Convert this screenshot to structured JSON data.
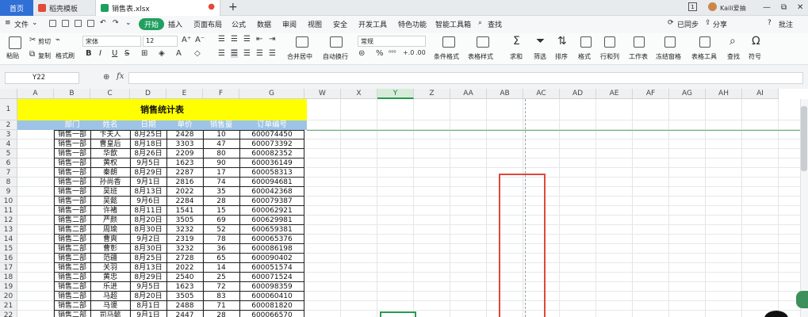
{
  "tabs": {
    "home": "首页",
    "template": "稻壳模板",
    "file": "销售表.xlsx",
    "add": "+"
  },
  "titlebar": {
    "badge": "1",
    "user": "Kaili爱抽",
    "min": "—",
    "restore": "⧉",
    "close": "✕"
  },
  "menu": {
    "file": "文件",
    "start": "开始",
    "insert": "插入",
    "layout": "页面布局",
    "formula": "公式",
    "data": "数据",
    "review": "审阅",
    "view": "视图",
    "security": "安全",
    "dev": "开发工具",
    "special": "特色功能",
    "smart": "智能工具箱",
    "search": "查找",
    "sync": "已同步",
    "share": "分享",
    "help": "?",
    "comment": "批注"
  },
  "ribbon": {
    "paste": "粘贴",
    "cut": "剪切",
    "copy": "复制",
    "format_painter": "格式刷",
    "font_name": "宋体",
    "font_size": "12",
    "merge": "合并居中",
    "wrap": "自动换行",
    "number_format": "常规",
    "percent": "%",
    "cond_format": "条件格式",
    "table_style": "表格样式",
    "sum": "求和",
    "filter": "筛选",
    "sort": "排序",
    "format": "格式",
    "rowcol": "行和列",
    "sheet": "工作表",
    "freeze": "冻结窗格",
    "table_tools": "表格工具",
    "find": "查找",
    "symbol": "符号",
    "bold": "B",
    "italic": "I",
    "underline": "U",
    "grow": "A⁺",
    "shrink": "A⁻"
  },
  "formula_bar": {
    "name_box": "Y22",
    "fx": "fx",
    "value": ""
  },
  "columns": [
    "A",
    "B",
    "C",
    "D",
    "E",
    "F",
    "G",
    "W",
    "X",
    "Y",
    "Z",
    "AA",
    "AB",
    "AC",
    "AD",
    "AE",
    "AF",
    "AG",
    "AH",
    "AI"
  ],
  "rows": [
    "1",
    "2",
    "3",
    "4",
    "5",
    "6",
    "7",
    "8",
    "9",
    "10",
    "11",
    "12",
    "13",
    "14",
    "15",
    "16",
    "17",
    "18",
    "19",
    "20",
    "21",
    "22"
  ],
  "sheet": {
    "title": "销售统计表",
    "headers": [
      "部门",
      "姓名",
      "日期",
      "单价",
      "销售量",
      "订单编号"
    ],
    "data": [
      [
        "销售一部",
        "卞夫人",
        "8月25日",
        "2428",
        "10",
        "600074450"
      ],
      [
        "销售一部",
        "曹皇后",
        "8月18日",
        "3303",
        "47",
        "600073392"
      ],
      [
        "销售一部",
        "华歆",
        "8月26日",
        "2209",
        "80",
        "600082352"
      ],
      [
        "销售一部",
        "黄权",
        "9月5日",
        "1623",
        "90",
        "600036149"
      ],
      [
        "销售一部",
        "秦朗",
        "8月29日",
        "2287",
        "17",
        "600058313"
      ],
      [
        "销售一部",
        "孙尚香",
        "9月1日",
        "2816",
        "74",
        "600094681"
      ],
      [
        "销售一部",
        "吴班",
        "8月13日",
        "2022",
        "35",
        "600042368"
      ],
      [
        "销售一部",
        "吴懿",
        "9月6日",
        "2284",
        "28",
        "600079387"
      ],
      [
        "销售一部",
        "许褚",
        "8月11日",
        "1541",
        "15",
        "600062921"
      ],
      [
        "销售二部",
        "严颜",
        "8月20日",
        "3505",
        "69",
        "600629981"
      ],
      [
        "销售二部",
        "周瑜",
        "8月30日",
        "3232",
        "52",
        "600659381"
      ],
      [
        "销售二部",
        "曹爽",
        "9月2日",
        "2319",
        "78",
        "600065376"
      ],
      [
        "销售二部",
        "曹彰",
        "8月30日",
        "3232",
        "36",
        "600086198"
      ],
      [
        "销售二部",
        "范疆",
        "8月25日",
        "2728",
        "65",
        "600090402"
      ],
      [
        "销售二部",
        "关羽",
        "8月13日",
        "2022",
        "14",
        "600051574"
      ],
      [
        "销售二部",
        "黄忠",
        "8月29日",
        "2540",
        "25",
        "600071524"
      ],
      [
        "销售二部",
        "乐进",
        "9月5日",
        "1623",
        "72",
        "600098359"
      ],
      [
        "销售二部",
        "马超",
        "8月20日",
        "3505",
        "83",
        "600060410"
      ],
      [
        "销售二部",
        "马谡",
        "8月1日",
        "2488",
        "71",
        "600081820"
      ],
      [
        "销售二部",
        "司马懿",
        "9月1日",
        "2447",
        "28",
        "600066570"
      ]
    ]
  }
}
